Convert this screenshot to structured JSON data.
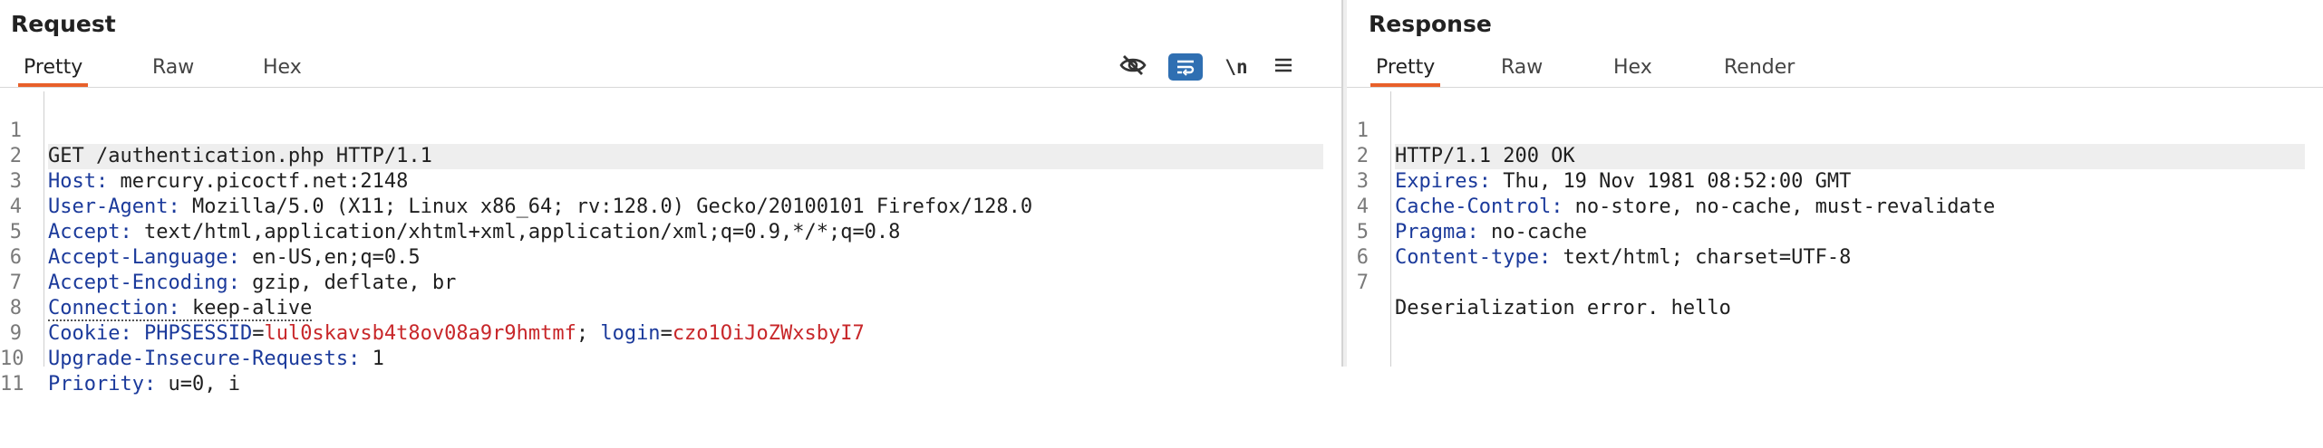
{
  "request": {
    "title": "Request",
    "tabs": [
      {
        "label": "Pretty",
        "active": true
      },
      {
        "label": "Raw",
        "active": false
      },
      {
        "label": "Hex",
        "active": false
      }
    ],
    "toolbar": {
      "hide_icon": "eye-slash-icon",
      "wrap_icon": "text-wrap-icon",
      "newline_label": "\\n",
      "menu_icon": "hamburger-menu-icon"
    },
    "lines": [
      {
        "n": "1",
        "text": "GET /authentication.php HTTP/1.1"
      },
      {
        "n": "2",
        "key": "Host",
        "value": " mercury.picoctf.net:2148"
      },
      {
        "n": "3",
        "key": "User-Agent",
        "value": " Mozilla/5.0 (X11; Linux x86_64; rv:128.0) Gecko/20100101 Firefox/128.0"
      },
      {
        "n": "4",
        "key": "Accept",
        "value": " text/html,application/xhtml+xml,application/xml;q=0.9,*/*;q=0.8"
      },
      {
        "n": "5",
        "key": "Accept-Language",
        "value": " en-US,en;q=0.5"
      },
      {
        "n": "6",
        "key": "Accept-Encoding",
        "value": " gzip, deflate, br"
      },
      {
        "n": "7",
        "key": "Connection",
        "value": " keep-alive"
      },
      {
        "n": "8",
        "key": "Cookie",
        "c1_name": "PHPSESSID",
        "c1_value": "lul0skavsb4t8ov08a9r9hmtmf",
        "sep": "; ",
        "c2_name": "login",
        "c2_value": "czo1OiJoZWxsbyI7"
      },
      {
        "n": "9",
        "key": "Upgrade-Insecure-Requests",
        "value": " 1"
      },
      {
        "n": "10",
        "key": "Priority",
        "value": " u=0, i"
      },
      {
        "n": "11",
        "text": ""
      }
    ]
  },
  "response": {
    "title": "Response",
    "tabs": [
      {
        "label": "Pretty",
        "active": true
      },
      {
        "label": "Raw",
        "active": false
      },
      {
        "label": "Hex",
        "active": false
      },
      {
        "label": "Render",
        "active": false
      }
    ],
    "lines": [
      {
        "n": "1",
        "text": "HTTP/1.1 200 OK"
      },
      {
        "n": "2",
        "key": "Expires",
        "value": " Thu, 19 Nov 1981 08:52:00 GMT"
      },
      {
        "n": "3",
        "key": "Cache-Control",
        "value": " no-store, no-cache, must-revalidate"
      },
      {
        "n": "4",
        "key": "Pragma",
        "value": " no-cache"
      },
      {
        "n": "5",
        "key": "Content-type",
        "value": " text/html; charset=UTF-8"
      },
      {
        "n": "6",
        "text": ""
      },
      {
        "n": "7",
        "text": "Deserialization error. hello"
      }
    ]
  },
  "colors": {
    "accent_tab_underline": "#e8602a",
    "header_key": "#1b3a9b",
    "cookie_value": "#c8272a",
    "selected_tool": "#2f6fb2"
  }
}
